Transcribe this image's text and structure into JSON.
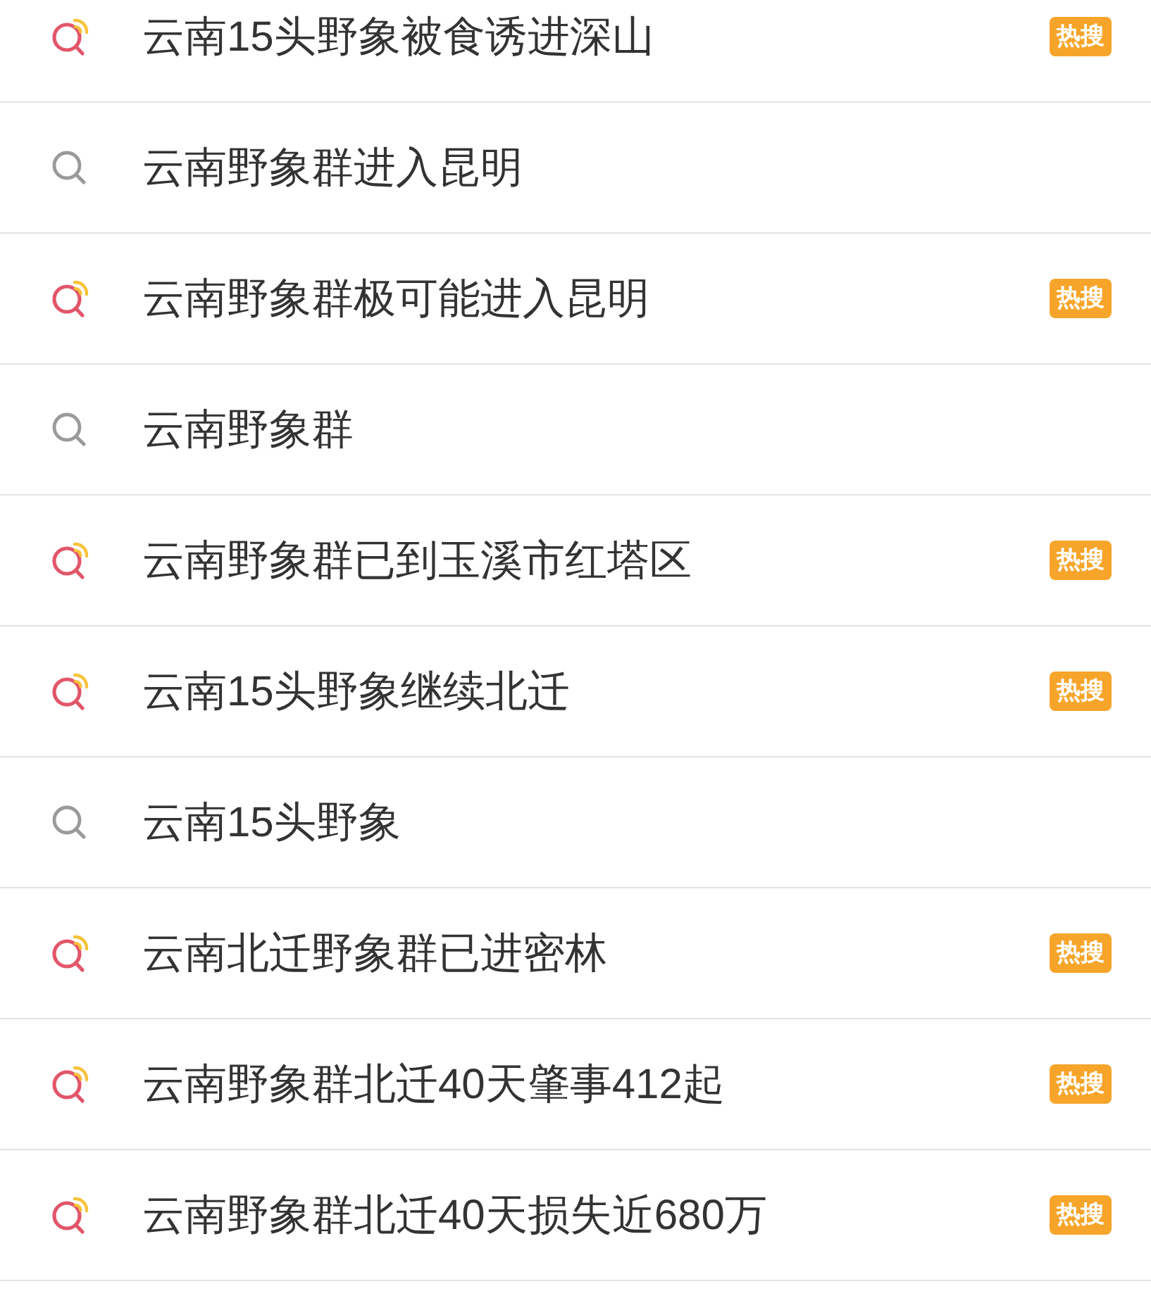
{
  "results": [
    {
      "kind": "hot",
      "text": "云南15头野象被食诱进深山",
      "badge": "热搜"
    },
    {
      "kind": "plain",
      "text": "云南野象群进入昆明"
    },
    {
      "kind": "hot",
      "text": "云南野象群极可能进入昆明",
      "badge": "热搜"
    },
    {
      "kind": "plain",
      "text": "云南野象群"
    },
    {
      "kind": "hot",
      "text": "云南野象群已到玉溪市红塔区",
      "badge": "热搜"
    },
    {
      "kind": "hot",
      "text": "云南15头野象继续北迁",
      "badge": "热搜"
    },
    {
      "kind": "plain",
      "text": "云南15头野象"
    },
    {
      "kind": "hot",
      "text": "云南北迁野象群已进密林",
      "badge": "热搜"
    },
    {
      "kind": "hot",
      "text": "云南野象群北迁40天肇事412起",
      "badge": "热搜"
    },
    {
      "kind": "hot",
      "text": "云南野象群北迁40天损失近680万",
      "badge": "热搜"
    }
  ]
}
